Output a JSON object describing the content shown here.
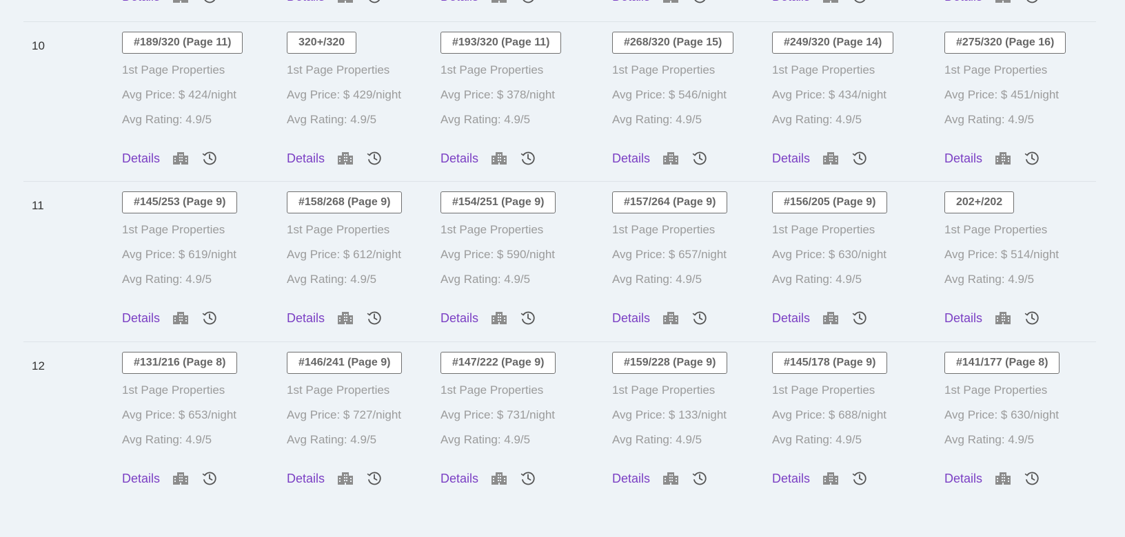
{
  "partial_row": {
    "cells": [
      {
        "details_label": "Details"
      },
      {
        "details_label": "Details"
      },
      {
        "details_label": "Details"
      },
      {
        "details_label": "Details"
      },
      {
        "details_label": "Details"
      },
      {
        "details_label": "Details"
      }
    ]
  },
  "rows": [
    {
      "number": "10",
      "cells": [
        {
          "rank": "#189/320 (Page 11)",
          "first_page": "1st Page Properties",
          "avg_price": "Avg Price: $ 424/night",
          "avg_rating": "Avg Rating: 4.9/5",
          "details_label": "Details"
        },
        {
          "rank": "320+/320",
          "first_page": "1st Page Properties",
          "avg_price": "Avg Price: $ 429/night",
          "avg_rating": "Avg Rating: 4.9/5",
          "details_label": "Details"
        },
        {
          "rank": "#193/320 (Page 11)",
          "first_page": "1st Page Properties",
          "avg_price": "Avg Price: $ 378/night",
          "avg_rating": "Avg Rating: 4.9/5",
          "details_label": "Details"
        },
        {
          "rank": "#268/320 (Page 15)",
          "first_page": "1st Page Properties",
          "avg_price": "Avg Price: $ 546/night",
          "avg_rating": "Avg Rating: 4.9/5",
          "details_label": "Details"
        },
        {
          "rank": "#249/320 (Page 14)",
          "first_page": "1st Page Properties",
          "avg_price": "Avg Price: $ 434/night",
          "avg_rating": "Avg Rating: 4.9/5",
          "details_label": "Details"
        },
        {
          "rank": "#275/320 (Page 16)",
          "first_page": "1st Page Properties",
          "avg_price": "Avg Price: $ 451/night",
          "avg_rating": "Avg Rating: 4.9/5",
          "details_label": "Details"
        }
      ]
    },
    {
      "number": "11",
      "cells": [
        {
          "rank": "#145/253 (Page 9)",
          "first_page": "1st Page Properties",
          "avg_price": "Avg Price: $ 619/night",
          "avg_rating": "Avg Rating: 4.9/5",
          "details_label": "Details"
        },
        {
          "rank": "#158/268 (Page 9)",
          "first_page": "1st Page Properties",
          "avg_price": "Avg Price: $ 612/night",
          "avg_rating": "Avg Rating: 4.9/5",
          "details_label": "Details"
        },
        {
          "rank": "#154/251 (Page 9)",
          "first_page": "1st Page Properties",
          "avg_price": "Avg Price: $ 590/night",
          "avg_rating": "Avg Rating: 4.9/5",
          "details_label": "Details"
        },
        {
          "rank": "#157/264 (Page 9)",
          "first_page": "1st Page Properties",
          "avg_price": "Avg Price: $ 657/night",
          "avg_rating": "Avg Rating: 4.9/5",
          "details_label": "Details"
        },
        {
          "rank": "#156/205 (Page 9)",
          "first_page": "1st Page Properties",
          "avg_price": "Avg Price: $ 630/night",
          "avg_rating": "Avg Rating: 4.9/5",
          "details_label": "Details"
        },
        {
          "rank": "202+/202",
          "first_page": "1st Page Properties",
          "avg_price": "Avg Price: $ 514/night",
          "avg_rating": "Avg Rating: 4.9/5",
          "details_label": "Details"
        }
      ]
    },
    {
      "number": "12",
      "cells": [
        {
          "rank": "#131/216 (Page 8)",
          "first_page": "1st Page Properties",
          "avg_price": "Avg Price: $ 653/night",
          "avg_rating": "Avg Rating: 4.9/5",
          "details_label": "Details"
        },
        {
          "rank": "#146/241 (Page 9)",
          "first_page": "1st Page Properties",
          "avg_price": "Avg Price: $ 727/night",
          "avg_rating": "Avg Rating: 4.9/5",
          "details_label": "Details"
        },
        {
          "rank": "#147/222 (Page 9)",
          "first_page": "1st Page Properties",
          "avg_price": "Avg Price: $ 731/night",
          "avg_rating": "Avg Rating: 4.9/5",
          "details_label": "Details"
        },
        {
          "rank": "#159/228 (Page 9)",
          "first_page": "1st Page Properties",
          "avg_price": "Avg Price: $ 133/night",
          "avg_rating": "Avg Rating: 4.9/5",
          "details_label": "Details"
        },
        {
          "rank": "#145/178 (Page 9)",
          "first_page": "1st Page Properties",
          "avg_price": "Avg Price: $ 688/night",
          "avg_rating": "Avg Rating: 4.9/5",
          "details_label": "Details"
        },
        {
          "rank": "#141/177 (Page 8)",
          "first_page": "1st Page Properties",
          "avg_price": "Avg Price: $ 630/night",
          "avg_rating": "Avg Rating: 4.9/5",
          "details_label": "Details"
        }
      ]
    }
  ],
  "icons": {
    "history": "history-clock-icon",
    "properties": "building-icon"
  },
  "colors": {
    "link": "#7b3fc4",
    "muted_text": "#9b9b9b",
    "badge_border": "#6f6f6f",
    "background": "#eef3f7"
  }
}
